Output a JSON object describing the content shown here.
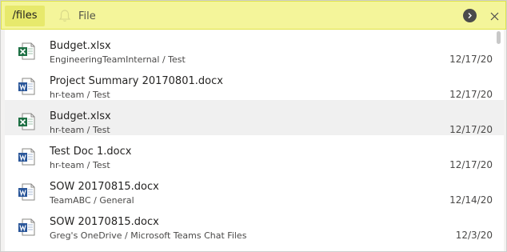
{
  "command_bar": {
    "command": "/files",
    "filter_label": "File",
    "go_icon": "chevron-right-icon",
    "close_icon": "close-icon",
    "bell_icon": "bell-icon"
  },
  "colors": {
    "command_bar_bg": "#f4f59a",
    "excel_green": "#1f7145",
    "word_blue": "#2b579a"
  },
  "files": [
    {
      "name": "Budget.xlsx",
      "location": "EngineeringTeamInternal / Test",
      "date": "12/17/20",
      "type": "excel"
    },
    {
      "name": "Project Summary 20170801.docx",
      "location": "hr-team / Test",
      "date": "12/17/20",
      "type": "word"
    },
    {
      "name": "Budget.xlsx",
      "location": "hr-team / Test",
      "date": "12/17/20",
      "type": "excel",
      "selected": true
    },
    {
      "name": "Test Doc 1.docx",
      "location": "hr-team / Test",
      "date": "12/17/20",
      "type": "word"
    },
    {
      "name": "SOW 20170815.docx",
      "location": "TeamABC / General",
      "date": "12/14/20",
      "type": "word"
    },
    {
      "name": "SOW 20170815.docx",
      "location": "Greg's OneDrive / Microsoft Teams Chat Files",
      "date": "12/3/20",
      "type": "word"
    }
  ]
}
